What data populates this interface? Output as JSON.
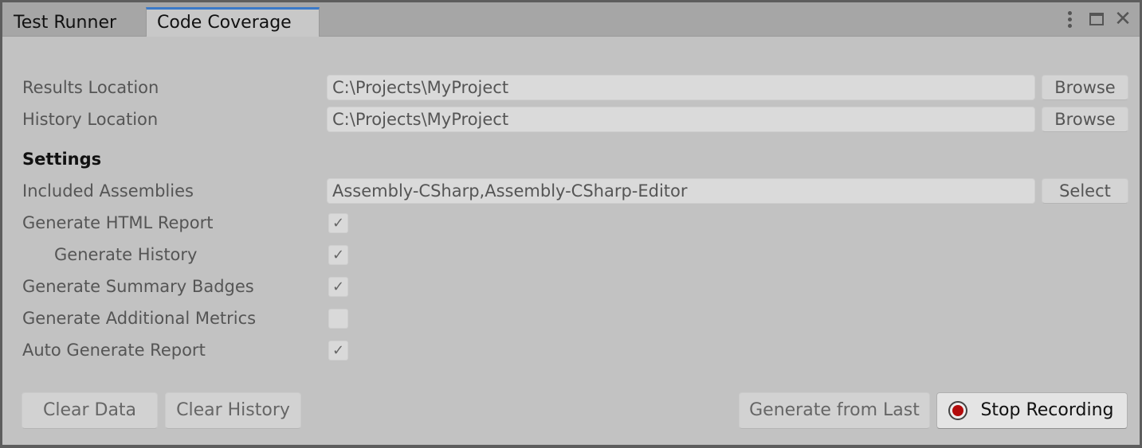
{
  "tabs": [
    {
      "label": "Test Runner",
      "active": false
    },
    {
      "label": "Code Coverage",
      "active": true
    }
  ],
  "window_controls": {
    "menu_icon": "kebab-menu-icon",
    "maximize_icon": "maximize-icon",
    "close_icon": "close-icon",
    "close_glyph": "✕"
  },
  "paths": {
    "results_location": {
      "label": "Results Location",
      "value": "C:\\Projects\\MyProject",
      "button": "Browse"
    },
    "history_location": {
      "label": "History Location",
      "value": "C:\\Projects\\MyProject",
      "button": "Browse"
    }
  },
  "settings": {
    "heading": "Settings",
    "included_assemblies": {
      "label": "Included Assemblies",
      "value": "Assembly-CSharp,Assembly-CSharp-Editor",
      "button": "Select"
    },
    "options": [
      {
        "label": "Generate HTML Report",
        "checked": true,
        "indent": false
      },
      {
        "label": "Generate History",
        "checked": true,
        "indent": true
      },
      {
        "label": "Generate Summary Badges",
        "checked": true,
        "indent": false
      },
      {
        "label": "Generate Additional Metrics",
        "checked": false,
        "indent": false
      },
      {
        "label": "Auto Generate Report",
        "checked": true,
        "indent": false
      }
    ],
    "check_glyph": "✓"
  },
  "actions": {
    "clear_data": "Clear Data",
    "clear_history": "Clear History",
    "generate_from_last": "Generate from Last",
    "stop_recording": "Stop Recording",
    "record_color": "#b30c0c"
  }
}
